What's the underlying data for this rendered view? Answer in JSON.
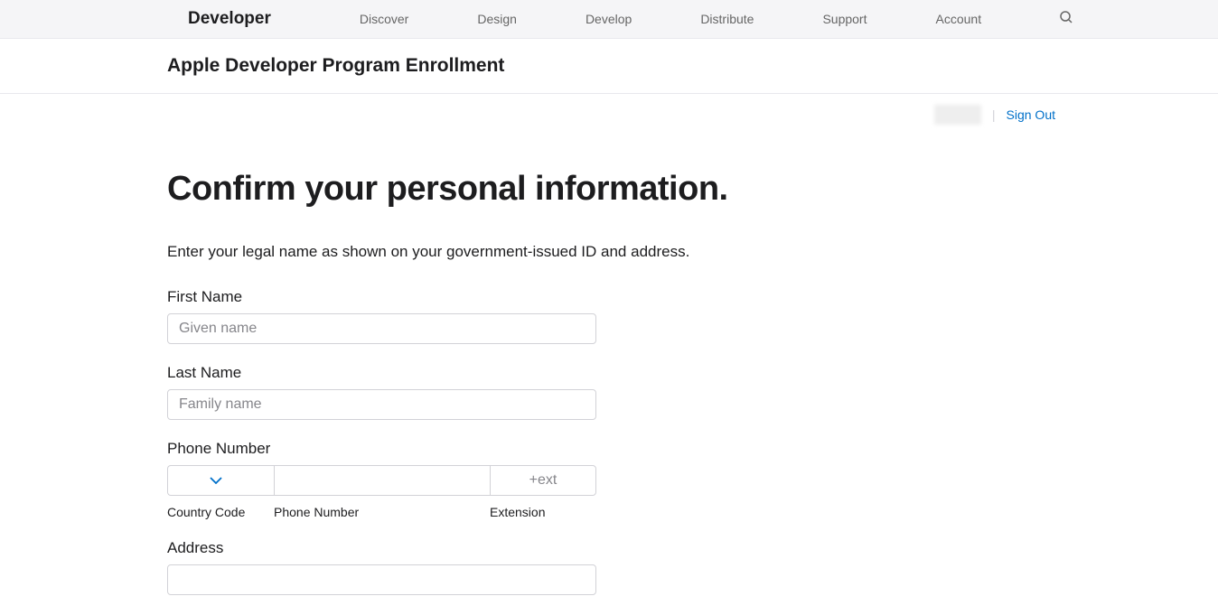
{
  "nav": {
    "brand": "Developer",
    "links": [
      "Discover",
      "Design",
      "Develop",
      "Distribute",
      "Support",
      "Account"
    ]
  },
  "subheader": {
    "title": "Apple Developer Program Enrollment"
  },
  "userbar": {
    "signout": "Sign Out"
  },
  "page": {
    "heading": "Confirm your personal information.",
    "instruction": "Enter your legal name as shown on your government-issued ID and address."
  },
  "form": {
    "firstName": {
      "label": "First Name",
      "placeholder": "Given name",
      "value": ""
    },
    "lastName": {
      "label": "Last Name",
      "placeholder": "Family name",
      "value": ""
    },
    "phone": {
      "label": "Phone Number",
      "countryCodeSublabel": "Country Code",
      "phoneSublabel": "Phone Number",
      "extSublabel": "Extension",
      "extPlaceholder": "+ext",
      "countryValue": "",
      "phoneValue": "",
      "extValue": ""
    },
    "address": {
      "label": "Address",
      "value": ""
    }
  }
}
